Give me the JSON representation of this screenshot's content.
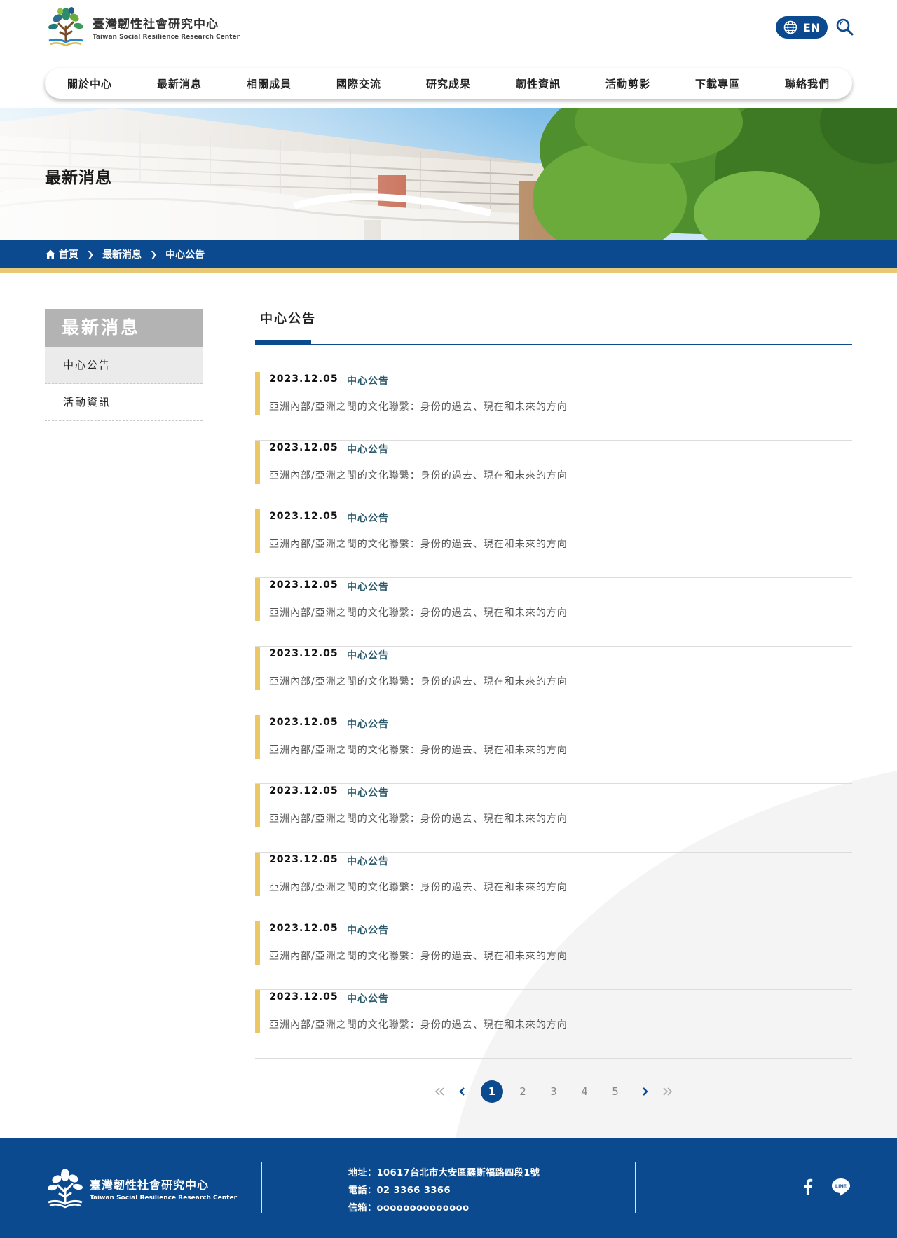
{
  "site": {
    "name_zh": "臺灣韌性社會研究中心",
    "name_en": "Taiwan Social Resilience Research Center"
  },
  "header": {
    "lang_label": "EN",
    "nav": [
      {
        "label": "關於中心"
      },
      {
        "label": "最新消息"
      },
      {
        "label": "相關成員"
      },
      {
        "label": "國際交流"
      },
      {
        "label": "研究成果"
      },
      {
        "label": "韌性資訊"
      },
      {
        "label": "活動剪影"
      },
      {
        "label": "下載專區"
      },
      {
        "label": "聯絡我們"
      }
    ]
  },
  "banner": {
    "title": "最新消息"
  },
  "breadcrumb": {
    "home": "首頁",
    "level1": "最新消息",
    "level2": "中心公告"
  },
  "sidebar": {
    "title": "最新消息",
    "items": [
      {
        "label": "中心公告",
        "active": true
      },
      {
        "label": "活動資訊",
        "active": false
      }
    ]
  },
  "main": {
    "section_title": "中心公告",
    "news": [
      {
        "date": "2023.12.05",
        "category": "中心公告",
        "title": "亞洲內部/亞洲之間的文化聯繫：身份的過去、現在和未來的方向"
      },
      {
        "date": "2023.12.05",
        "category": "中心公告",
        "title": "亞洲內部/亞洲之間的文化聯繫：身份的過去、現在和未來的方向"
      },
      {
        "date": "2023.12.05",
        "category": "中心公告",
        "title": "亞洲內部/亞洲之間的文化聯繫：身份的過去、現在和未來的方向"
      },
      {
        "date": "2023.12.05",
        "category": "中心公告",
        "title": "亞洲內部/亞洲之間的文化聯繫：身份的過去、現在和未來的方向"
      },
      {
        "date": "2023.12.05",
        "category": "中心公告",
        "title": "亞洲內部/亞洲之間的文化聯繫：身份的過去、現在和未來的方向"
      },
      {
        "date": "2023.12.05",
        "category": "中心公告",
        "title": "亞洲內部/亞洲之間的文化聯繫：身份的過去、現在和未來的方向"
      },
      {
        "date": "2023.12.05",
        "category": "中心公告",
        "title": "亞洲內部/亞洲之間的文化聯繫：身份的過去、現在和未來的方向"
      },
      {
        "date": "2023.12.05",
        "category": "中心公告",
        "title": "亞洲內部/亞洲之間的文化聯繫：身份的過去、現在和未來的方向"
      },
      {
        "date": "2023.12.05",
        "category": "中心公告",
        "title": "亞洲內部/亞洲之間的文化聯繫：身份的過去、現在和未來的方向"
      },
      {
        "date": "2023.12.05",
        "category": "中心公告",
        "title": "亞洲內部/亞洲之間的文化聯繫：身份的過去、現在和未來的方向"
      }
    ]
  },
  "pagination": {
    "pages": [
      "1",
      "2",
      "3",
      "4",
      "5"
    ],
    "current": "1"
  },
  "footer": {
    "address": "地址：10617台北市大安區羅斯福路四段1號",
    "phone": "電話：02 3366 3366",
    "email": "信箱：oooooooooooooo"
  },
  "colors": {
    "primary": "#0b4a8e",
    "accent": "#e6c877",
    "news_bar": "#ecc766",
    "category_text": "#2b5a6c"
  },
  "icons": [
    "globe-icon",
    "search-icon",
    "home-icon",
    "chevron-right-icon",
    "double-chevron-left-icon",
    "chevron-left-icon",
    "double-chevron-right-icon",
    "facebook-icon",
    "line-icon"
  ]
}
